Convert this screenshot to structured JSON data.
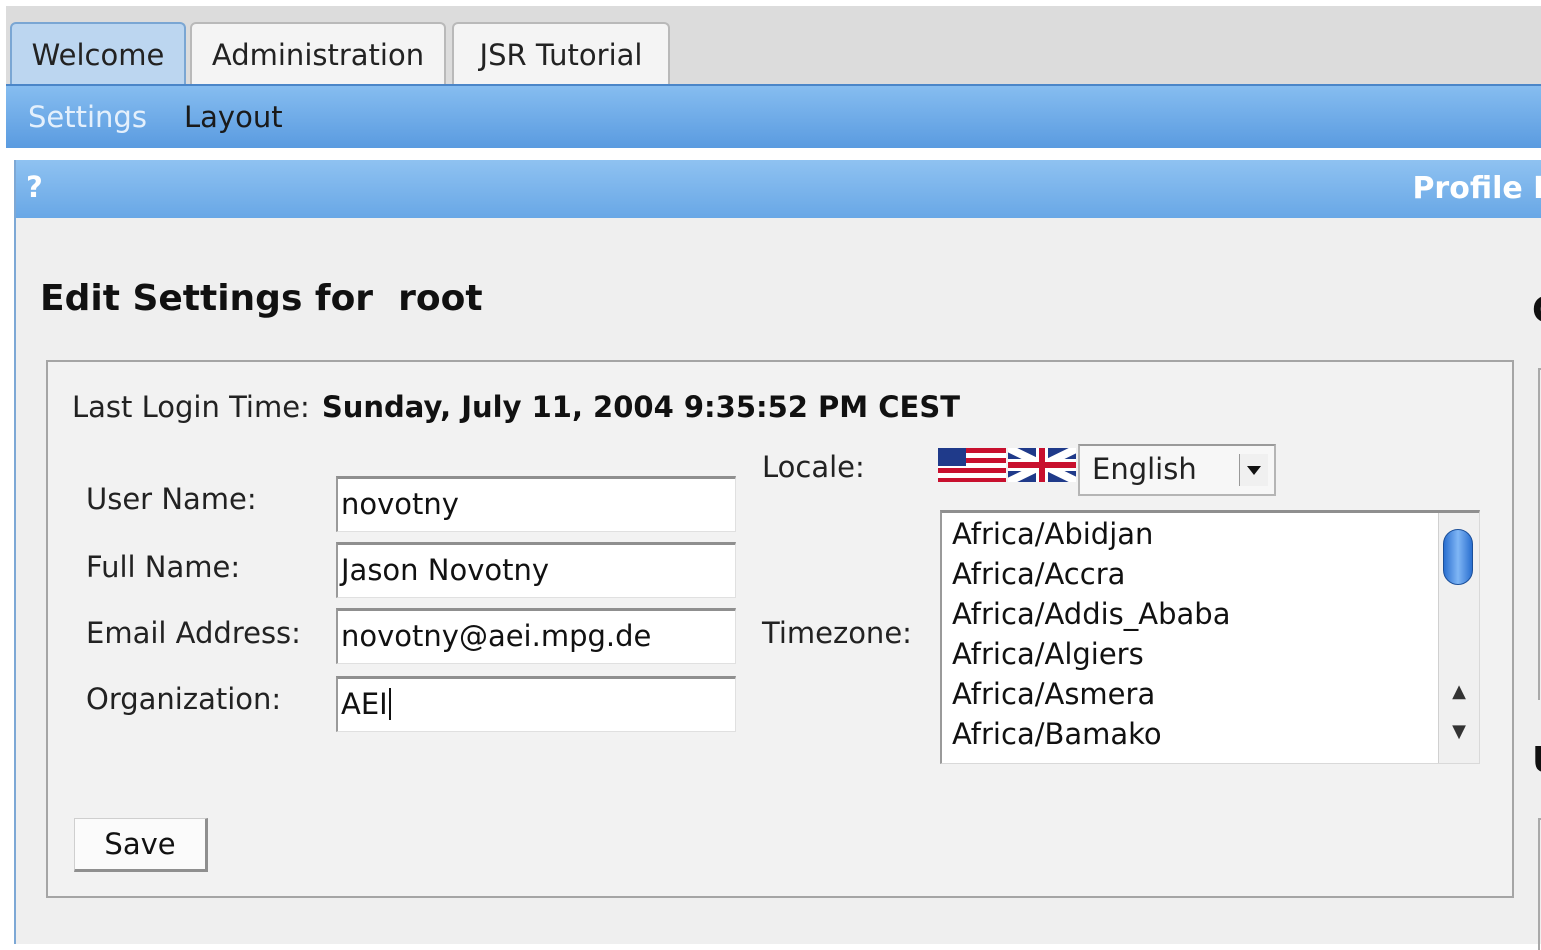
{
  "tabs": [
    {
      "label": "Welcome",
      "active": true
    },
    {
      "label": "Administration",
      "active": false
    },
    {
      "label": "JSR Tutorial",
      "active": false
    }
  ],
  "submenu": [
    {
      "label": "Settings",
      "active": true
    },
    {
      "label": "Layout",
      "active": false
    }
  ],
  "portlet": {
    "help_label": "?",
    "title_fragment": "Profile M",
    "heading": "Edit Settings for  root",
    "right_cut_1": "C",
    "right_cut_2": "U"
  },
  "form": {
    "last_login_label": "Last Login Time:",
    "last_login_value": "Sunday, July 11, 2004 9:35:52 PM CEST",
    "user_name_label": "User Name:",
    "user_name_value": "novotny",
    "full_name_label": "Full Name:",
    "full_name_value": "Jason Novotny",
    "email_label": "Email Address:",
    "email_value": "novotny@aei.mpg.de",
    "organization_label": "Organization:",
    "organization_value": "AEI",
    "locale_label": "Locale:",
    "locale_value": "English",
    "timezone_label": "Timezone:",
    "timezones": [
      "Africa/Abidjan",
      "Africa/Accra",
      "Africa/Addis_Ababa",
      "Africa/Algiers",
      "Africa/Asmera",
      "Africa/Bamako"
    ],
    "save_label": "Save"
  },
  "icons": {
    "scroll_up": "▲",
    "scroll_down": "▼"
  },
  "colors": {
    "submenu_blue": "#5a9be0",
    "portlet_title_blue": "#68a7e6",
    "scroll_thumb": "#2a6fd0"
  }
}
